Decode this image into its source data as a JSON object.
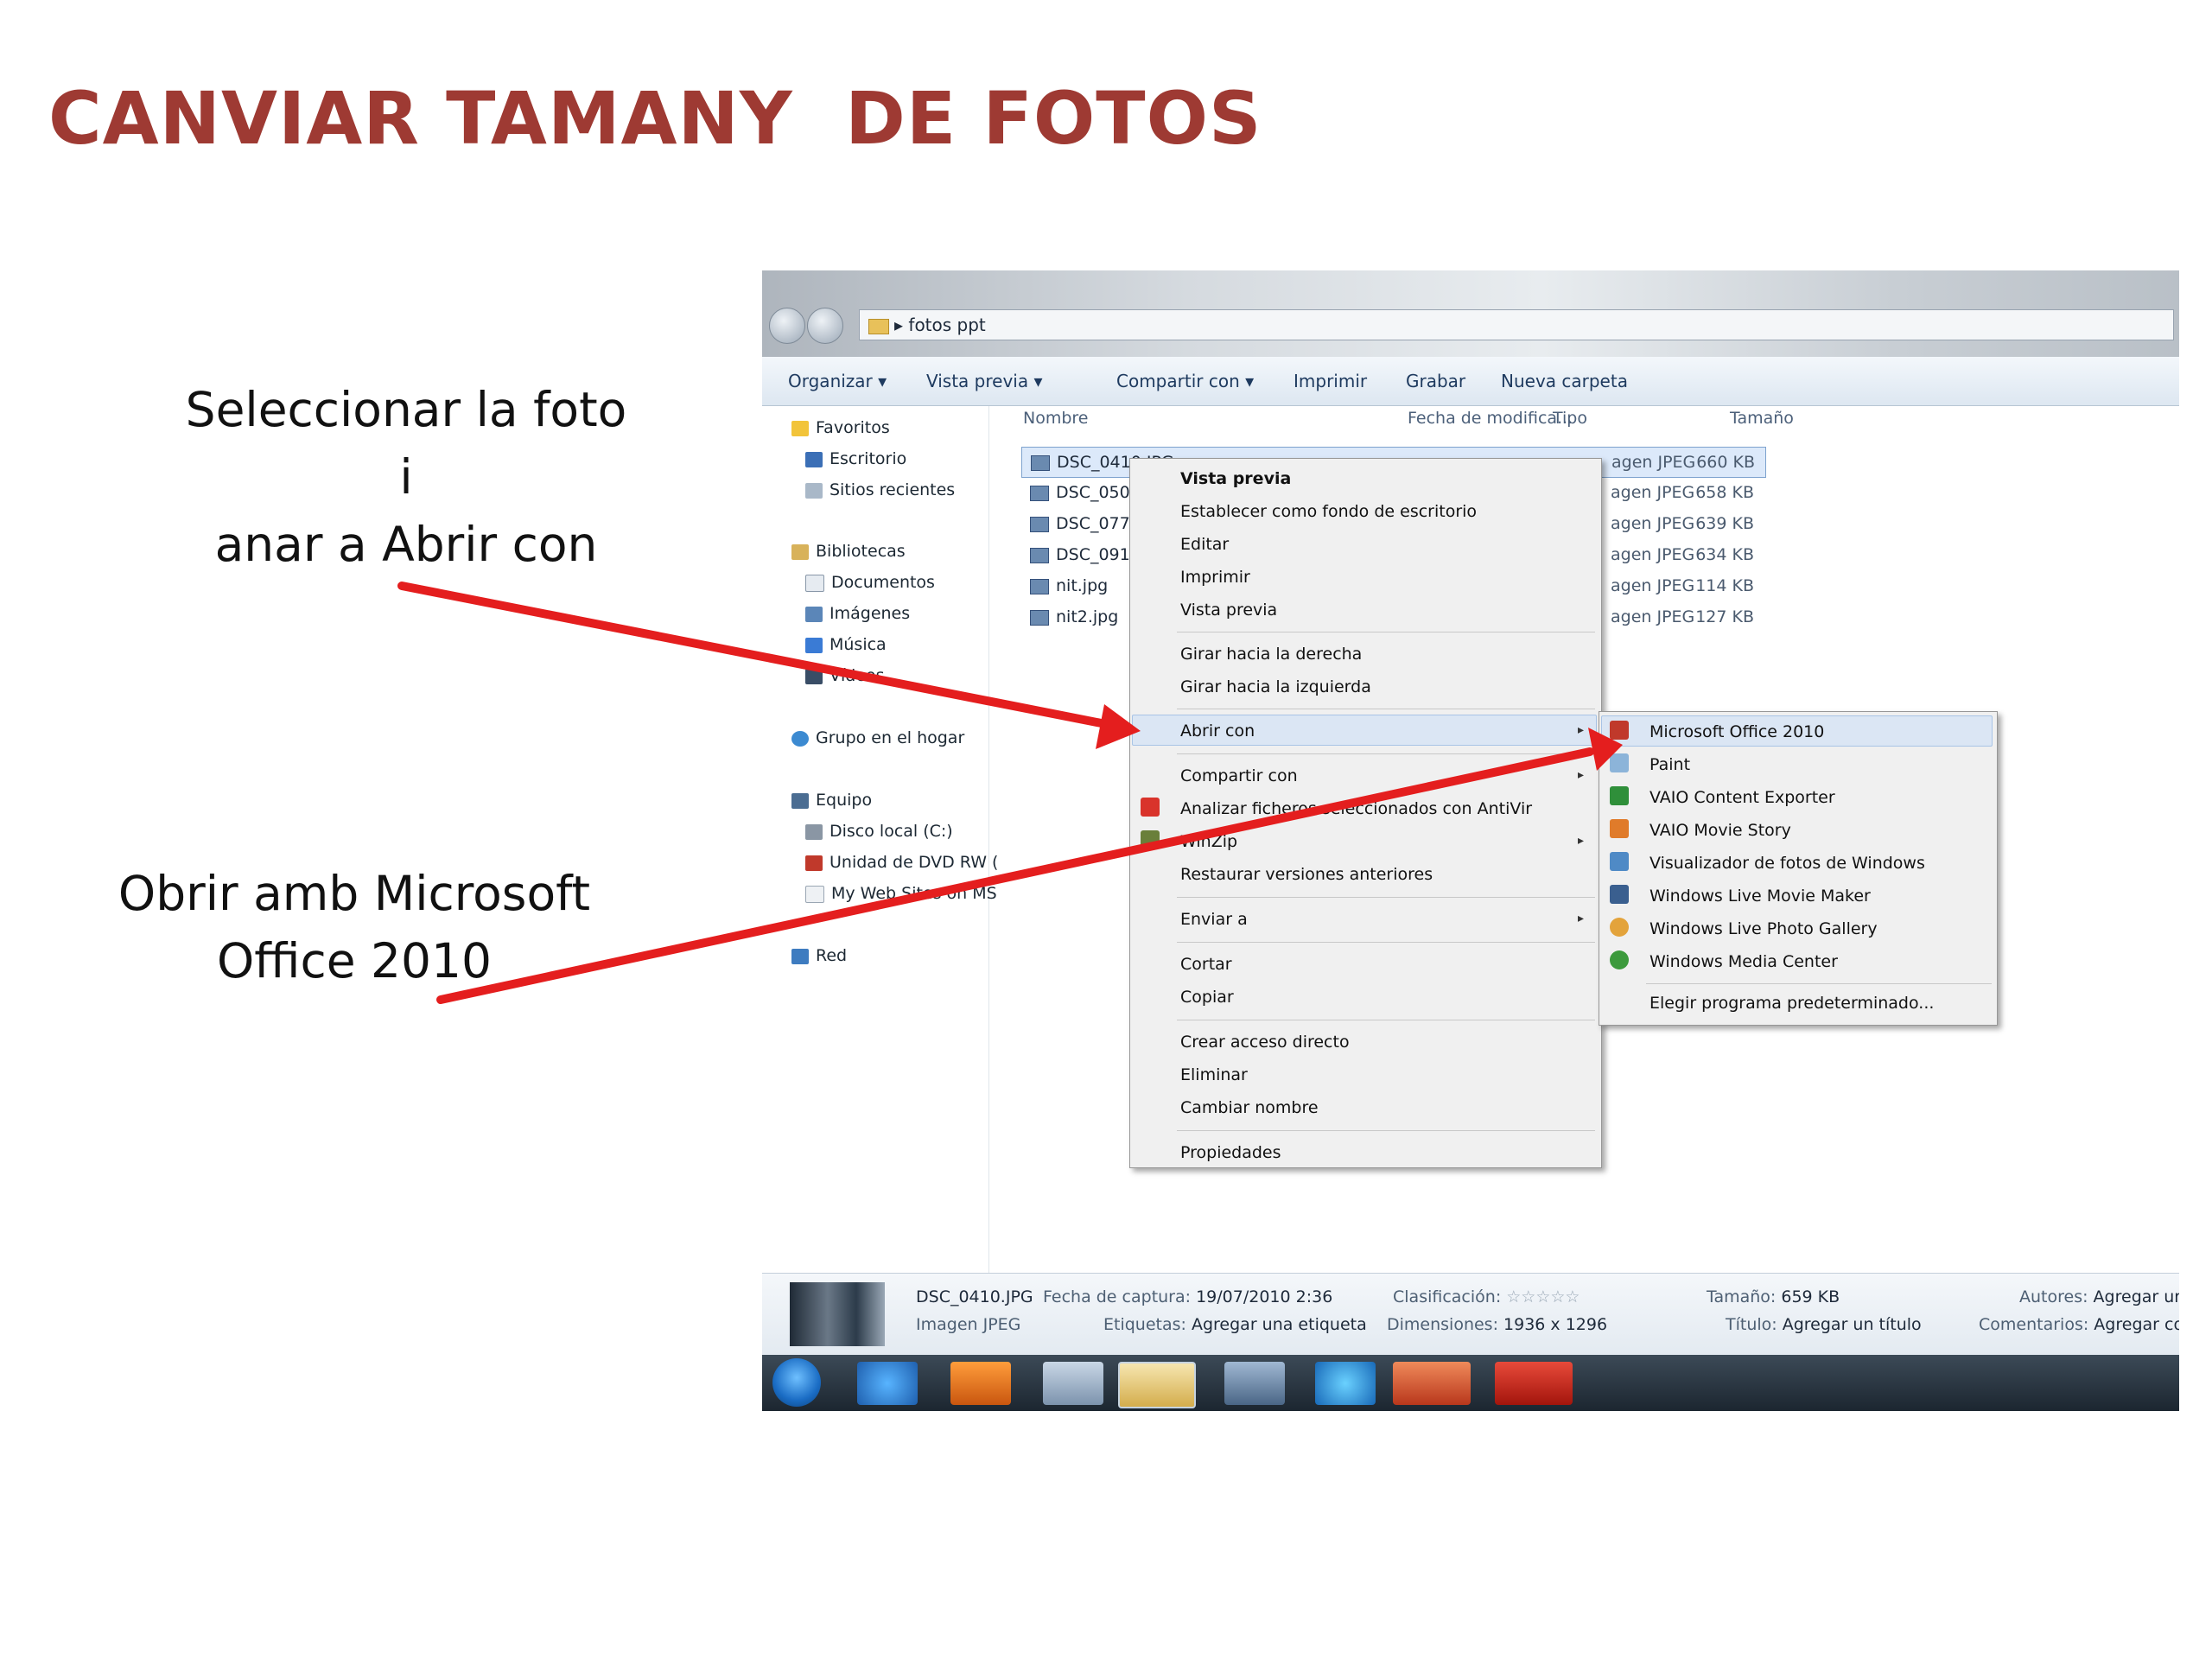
{
  "slide": {
    "title": "CANVIAR TAMANY  DE FOTOS",
    "caption1_lines": [
      "Seleccionar la foto",
      "i",
      "anar a Abrir con"
    ],
    "caption2_lines": [
      "Obrir amb Microsoft",
      "Office 2010"
    ],
    "arrow_color": "#e41e1e",
    "title_color": "#9e3a33"
  },
  "explorer": {
    "breadcrumb": "fotos ppt",
    "toolbar": [
      "Organizar",
      "Vista previa",
      "Compartir con",
      "Imprimir",
      "Grabar",
      "Nueva carpeta"
    ],
    "nav": {
      "favorites": "Favoritos",
      "favorites_items": [
        "Escritorio",
        "Sitios recientes"
      ],
      "libraries": "Bibliotecas",
      "libraries_items": [
        "Documentos",
        "Imágenes",
        "Música",
        "Vídeos"
      ],
      "homegroup": "Grupo en el hogar",
      "computer": "Equipo",
      "computer_items": [
        "Disco local (C:)",
        "Unidad de DVD RW (",
        "My Web Sites on MS"
      ],
      "network": "Red"
    },
    "columns": [
      "Nombre",
      "Fecha de modifica...",
      "Tipo",
      "Tamaño"
    ],
    "files": [
      {
        "name": "DSC_0410.JPG",
        "type": "agen JPEG",
        "size": "660 KB",
        "selected": true
      },
      {
        "name": "DSC_0509.",
        "type": "agen JPEG",
        "size": "658 KB"
      },
      {
        "name": "DSC_0777.",
        "type": "agen JPEG",
        "size": "639 KB"
      },
      {
        "name": "DSC_0911.",
        "type": "agen JPEG",
        "size": "634 KB"
      },
      {
        "name": "nit.jpg",
        "type": "agen JPEG",
        "size": "114 KB"
      },
      {
        "name": "nit2.jpg",
        "type": "agen JPEG",
        "size": "127 KB"
      }
    ],
    "context_menu": {
      "items": [
        "Vista previa",
        "Establecer como fondo de escritorio",
        "Editar",
        "Imprimir",
        "Vista previa",
        "Girar hacia la derecha",
        "Girar hacia la izquierda",
        "Abrir con",
        "Compartir con",
        "Analizar ficheros seleccionados con AntiVir",
        "WinZip",
        "Restaurar versiones anteriores",
        "Enviar a",
        "Cortar",
        "Copiar",
        "Crear acceso directo",
        "Eliminar",
        "Cambiar nombre",
        "Propiedades"
      ]
    },
    "open_with_menu": {
      "items": [
        "Microsoft Office 2010",
        "Paint",
        "VAIO Content Exporter",
        "VAIO Movie Story",
        "Visualizador de fotos de Windows",
        "Windows Live Movie Maker",
        "Windows Live Photo Gallery",
        "Windows Media Center",
        "Elegir programa predeterminado..."
      ]
    },
    "details": {
      "filename": "DSC_0410.JPG",
      "filetype": "Imagen JPEG",
      "capture_label": "Fecha de captura:",
      "capture_value": "19/07/2010 2:36",
      "tags_label": "Etiquetas:",
      "tags_value": "Agregar una etiqueta",
      "rating_label": "Clasificación:",
      "rating_value": 0,
      "dims_label": "Dimensiones:",
      "dims_value": "1936 x 1296",
      "size_label": "Tamaño:",
      "size_value": "659 KB",
      "title_label": "Título:",
      "title_value": "Agregar un título",
      "authors_label": "Autores:",
      "authors_value": "Agregar ur",
      "comments_label": "Comentarios:",
      "comments_value": "Agregar co"
    },
    "taskbar_icons": [
      "start-orb-icon",
      "internet-explorer-icon",
      "media-player-icon",
      "network-icon",
      "explorer-icon",
      "photos-icon",
      "refresh-icon",
      "powerpoint-icon",
      "acrobat-icon"
    ]
  }
}
